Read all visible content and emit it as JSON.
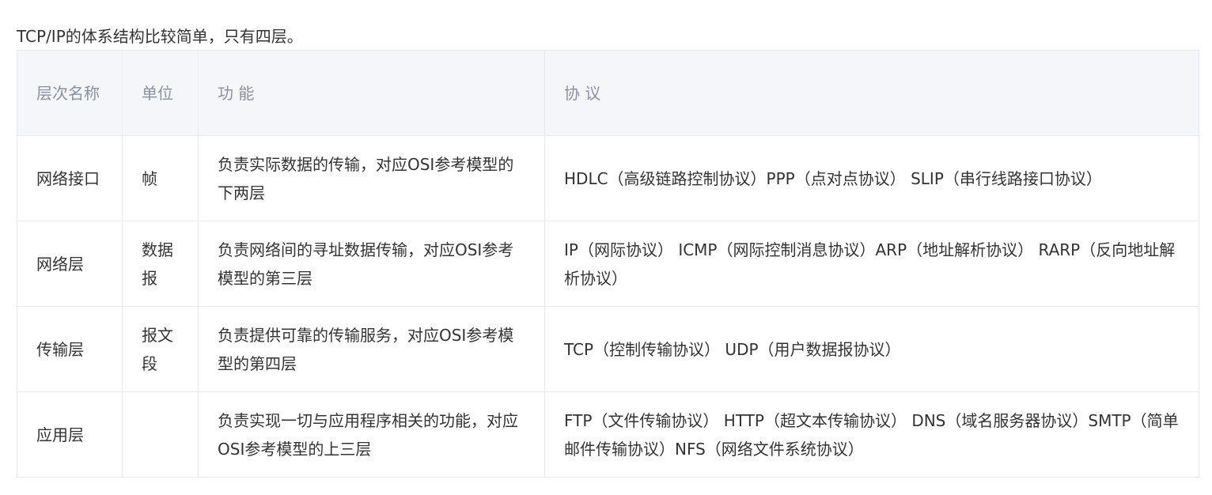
{
  "intro": "TCP/IP的体系结构比较简单，只有四层。",
  "table": {
    "headers": [
      "层次名称",
      "单位",
      "功 能",
      "协 议"
    ],
    "rows": [
      {
        "layer": "网络接口",
        "unit": "帧",
        "function": "负责实际数据的传输，对应OSI参考模型的下两层",
        "protocols": "HDLC（高级链路控制协议）PPP（点对点协议） SLIP（串行线路接口协议）"
      },
      {
        "layer": "网络层",
        "unit": "数据报",
        "function": "负责网络间的寻址数据传输，对应OSI参考模型的第三层",
        "protocols": "IP（网际协议） ICMP（网际控制消息协议）ARP（地址解析协议） RARP（反向地址解析协议）"
      },
      {
        "layer": "传输层",
        "unit": "报文段",
        "function": "负责提供可靠的传输服务，对应OSI参考模型的第四层",
        "protocols": "TCP（控制传输协议） UDP（用户数据报协议）"
      },
      {
        "layer": "应用层",
        "unit": "",
        "function": "负责实现一切与应用程序相关的功能，对应OSI参考模型的上三层",
        "protocols": "FTP（文件传输协议） HTTP（超文本传输协议） DNS（域名服务器协议）SMTP（简单邮件传输协议）NFS（网络文件系统协议）"
      }
    ]
  }
}
